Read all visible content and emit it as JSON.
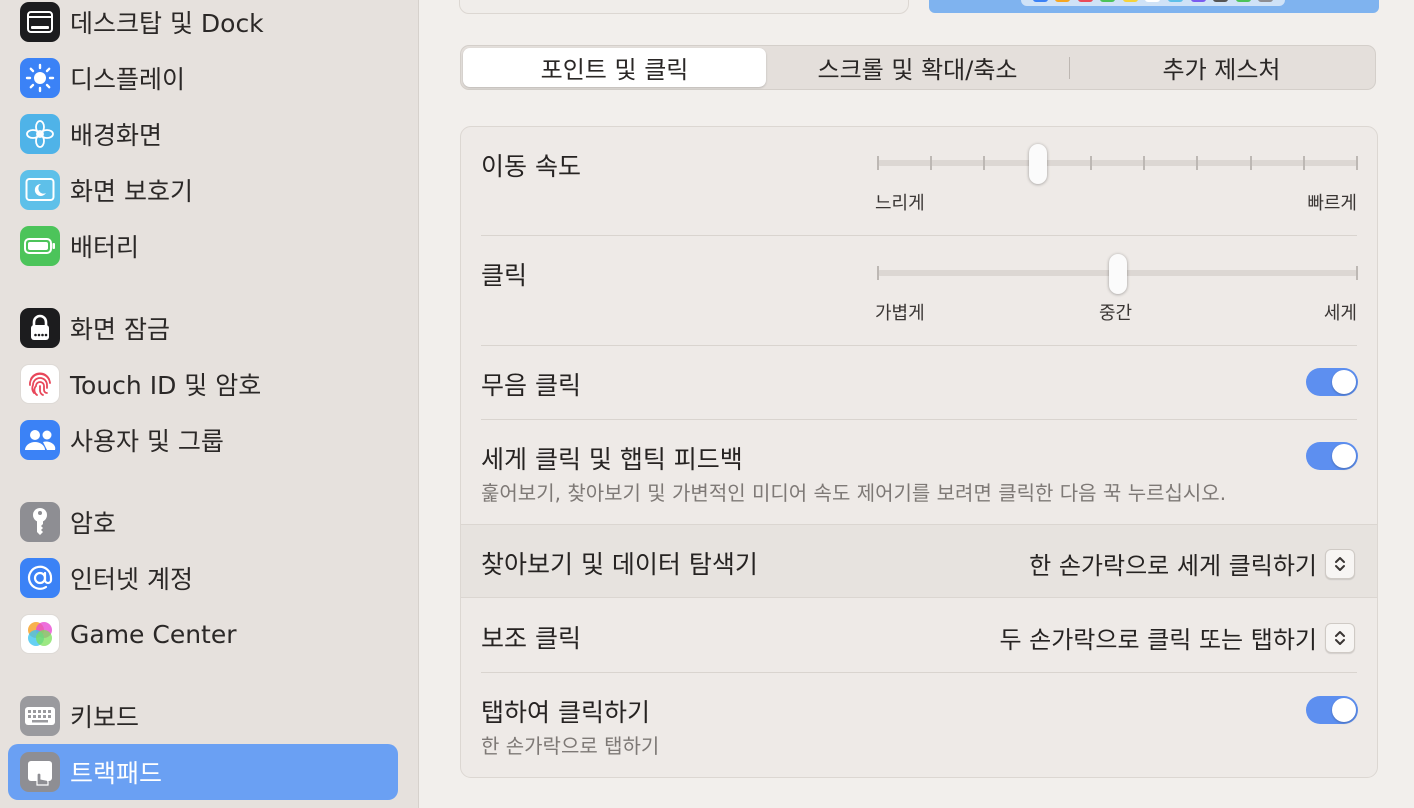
{
  "sidebar": {
    "items": [
      {
        "label": "데스크탑 및 Dock",
        "icon": "desktop-dock-icon"
      },
      {
        "label": "디스플레이",
        "icon": "display-icon"
      },
      {
        "label": "배경화면",
        "icon": "wallpaper-icon"
      },
      {
        "label": "화면 보호기",
        "icon": "screensaver-icon"
      },
      {
        "label": "배터리",
        "icon": "battery-icon"
      },
      {
        "label": "화면 잠금",
        "icon": "lock-screen-icon"
      },
      {
        "label": "Touch ID 및 암호",
        "icon": "fingerprint-icon"
      },
      {
        "label": "사용자 및 그룹",
        "icon": "users-groups-icon"
      },
      {
        "label": "암호",
        "icon": "key-icon"
      },
      {
        "label": "인터넷 계정",
        "icon": "at-sign-icon"
      },
      {
        "label": "Game Center",
        "icon": "game-center-icon"
      },
      {
        "label": "키보드",
        "icon": "keyboard-icon"
      },
      {
        "label": "트랙패드",
        "icon": "trackpad-icon"
      }
    ],
    "selected": "트랙패드"
  },
  "tabs": [
    {
      "label": "포인트 및 클릭",
      "active": true
    },
    {
      "label": "스크롤 및 확대/축소",
      "active": false
    },
    {
      "label": "추가 제스처",
      "active": false
    }
  ],
  "settings": {
    "tracking_speed": {
      "label": "이동 속도",
      "min_label": "느리게",
      "max_label": "빠르게",
      "ticks": 10,
      "value_index": 3
    },
    "click": {
      "label": "클릭",
      "left_label": "가볍게",
      "mid_label": "중간",
      "right_label": "세게",
      "value_fraction": 0.5
    },
    "silent_click": {
      "label": "무음 클릭",
      "on": true
    },
    "force_click": {
      "label": "세게 클릭 및 햅틱 피드백",
      "description": "훑어보기, 찾아보기 및 가변적인 미디어 속도 제어기를 보려면 클릭한 다음 꾹 누르십시오.",
      "on": true
    },
    "lookup": {
      "label": "찾아보기 및 데이터 탐색기",
      "value": "한 손가락으로 세게 클릭하기"
    },
    "secondary_click": {
      "label": "보조 클릭",
      "value": "두 손가락으로 클릭 또는 탭하기"
    },
    "tap_to_click": {
      "label": "탭하여 클릭하기",
      "description": "한 손가락으로 탭하기",
      "on": true
    }
  },
  "colors": {
    "accent": "#5d8ff0",
    "sidebar_selected": "#6aa0f3"
  }
}
